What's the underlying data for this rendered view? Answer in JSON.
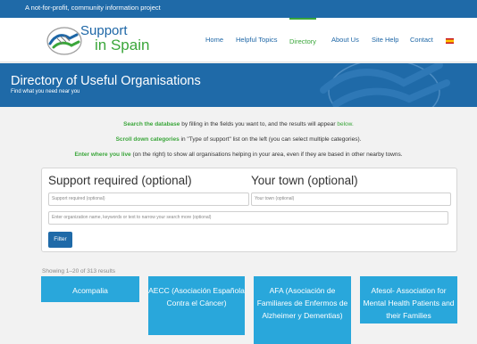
{
  "topbar": {
    "tagline": "A not-for-profit, community information project"
  },
  "logo": {
    "line1": "Support",
    "line2": "in Spain"
  },
  "nav": {
    "items": [
      {
        "label": "Home",
        "active": false
      },
      {
        "label": "Helpful Topics",
        "active": false
      },
      {
        "label": "Directory",
        "active": true
      },
      {
        "label": "About Us",
        "active": false
      },
      {
        "label": "Site Help",
        "active": false
      },
      {
        "label": "Contact",
        "active": false
      }
    ],
    "flag_icon": "spain-flag-icon"
  },
  "banner": {
    "title": "Directory of Useful Organisations",
    "subtitle": "Find what you need near you"
  },
  "intro": {
    "line1_bold": "Search the database",
    "line1_text": " by filling in the fields you want to, and the results will appear ",
    "line1_link": "below.",
    "line2_bold": "Scroll down categories",
    "line2_text": " in \"Type of support\" list on the left (you can select multiple categories).",
    "line3_bold": "Enter where you live",
    "line3_text": " (on the right) to show all organisations helping in your area, even if they are based in other nearby towns."
  },
  "form": {
    "support_heading": "Support required (optional)",
    "town_heading": "Your town (optional)",
    "support_placeholder": "Support required (optional)",
    "town_placeholder": "Your town (optional)",
    "keyword_placeholder": "Enter organization name, keywords or text to narrow your search more (optional)",
    "filter_label": "Filter"
  },
  "results": {
    "count_text": "Showing 1–20 of 313 results",
    "cards": [
      {
        "title": "Acompalia"
      },
      {
        "title": "AECC (Asociación Española Contra el Cáncer)"
      },
      {
        "title": "AFA (Asociación de Familiares de Enfermos de Alzheimer y Dementias)"
      },
      {
        "title": "Afesol- Association for Mental Health Patients and their Families"
      }
    ]
  },
  "colors": {
    "primary_blue": "#1f6aa8",
    "accent_green": "#3aa63a",
    "card_blue": "#29a7db"
  }
}
